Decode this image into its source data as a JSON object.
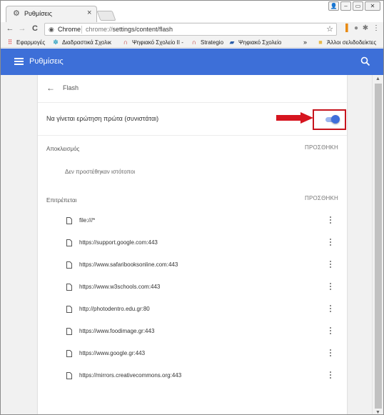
{
  "tab": {
    "title": "Ρυθμίσεις",
    "icon": "gear-icon",
    "close": "×"
  },
  "window_controls": {
    "user": "👤",
    "minimize": "–",
    "maximize": "▭",
    "close": "✕"
  },
  "toolbar": {
    "back": "←",
    "forward": "→",
    "reload": "C",
    "omnibox_label": "Chrome",
    "url_prefix": "chrome://",
    "url_rest": "settings/content/flash",
    "star": "☆",
    "menu": "⋮"
  },
  "bookmarks": {
    "items": [
      {
        "label": "Εφαρμογές",
        "icon": "apps-grid-icon"
      },
      {
        "label": "Διαδραστικά Σχολικ",
        "icon": "puzzle-icon"
      },
      {
        "label": "Ψηφιακό Σχολείο II -",
        "icon": "arch-icon"
      },
      {
        "label": "Strategio",
        "icon": "arch-icon"
      },
      {
        "label": "Ψηφιακό Σχολείο",
        "icon": "photo-icon"
      }
    ],
    "overflow": "»",
    "other_label": "Άλλοι σελιδοδείκτες"
  },
  "header": {
    "title": "Ρυθμίσεις"
  },
  "flash": {
    "title": "Flash",
    "ask_first_label": "Να γίνεται ερώτηση πρώτα (συνιστάται)",
    "ask_first_enabled": true,
    "block": {
      "title": "Αποκλεισμός",
      "add_label": "ΠΡΟΣΘΗΚΗ",
      "empty_text": "Δεν προστέθηκαν ιστότοποι"
    },
    "allow": {
      "title": "Επιτρέπεται",
      "add_label": "ΠΡΟΣΘΗΚΗ",
      "sites": [
        "file:///*",
        "https://support.google.com:443",
        "https://www.safaribooksonline.com:443",
        "https://www.w3schools.com:443",
        "http://photodentro.edu.gr:80",
        "https://www.foodimage.gr:443",
        "https://www.google.gr:443",
        "https://mirrors.creativecommons.org:443"
      ]
    }
  },
  "colors": {
    "header_blue": "#3d6fd8",
    "toggle_blue": "#3f6fdb",
    "highlight_red": "#c6141d"
  }
}
